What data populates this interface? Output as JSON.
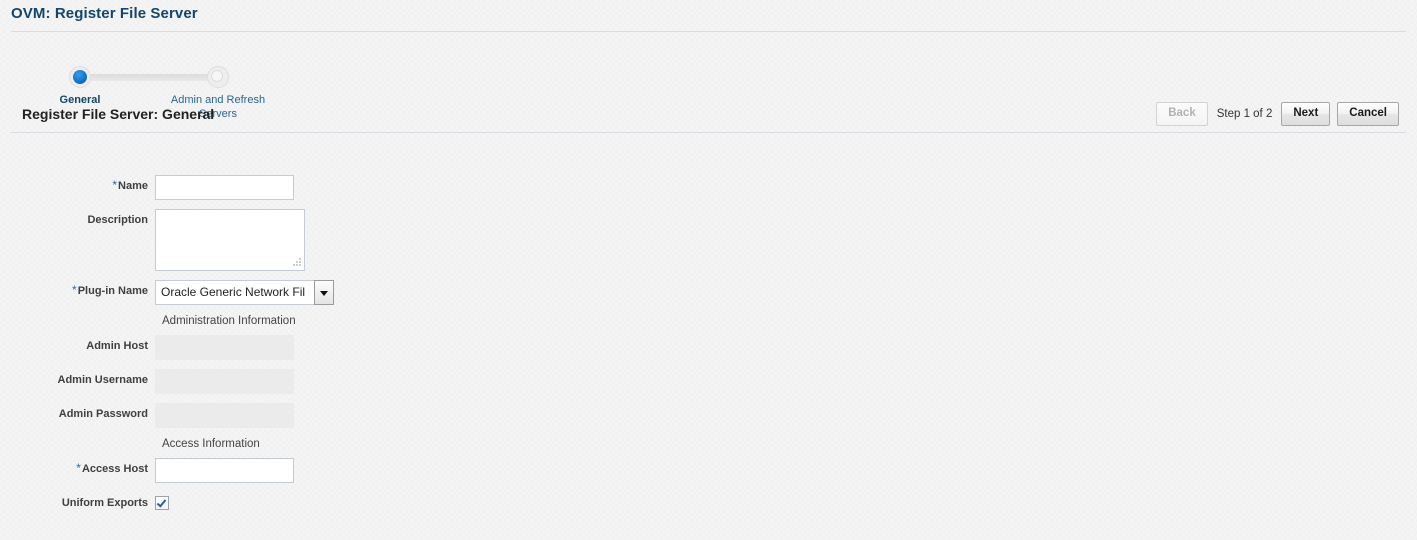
{
  "page": {
    "title": "OVM: Register File Server"
  },
  "train": {
    "steps": [
      {
        "label": "General",
        "state": "current"
      },
      {
        "label": "Admin and Refresh Servers",
        "state": "pending"
      }
    ]
  },
  "section": {
    "title": "Register File Server: General",
    "step_text": "Step 1 of 2",
    "buttons": {
      "back": "Back",
      "next": "Next",
      "cancel": "Cancel"
    }
  },
  "form": {
    "name": {
      "label": "Name",
      "required": true,
      "value": "",
      "placeholder": ""
    },
    "description": {
      "label": "Description",
      "required": false,
      "value": "",
      "placeholder": ""
    },
    "plugin_name": {
      "label": "Plug-in Name",
      "required": true,
      "value": "Oracle Generic Network Fil"
    },
    "admin_info_header": "Administration Information",
    "admin_host": {
      "label": "Admin Host",
      "required": false,
      "value": "",
      "disabled": true
    },
    "admin_username": {
      "label": "Admin Username",
      "required": false,
      "value": "",
      "disabled": true
    },
    "admin_password": {
      "label": "Admin Password",
      "required": false,
      "value": "",
      "disabled": true
    },
    "access_info_header": "Access Information",
    "access_host": {
      "label": "Access Host",
      "required": true,
      "value": "",
      "placeholder": ""
    },
    "uniform_exports": {
      "label": "Uniform Exports",
      "checked": true
    }
  },
  "colors": {
    "page_title": "#14456b",
    "required_marker": "#1e6bb8",
    "train_active": "#0a69c8",
    "link": "#2a6496",
    "background": "#f4f4f4"
  },
  "icons": {
    "dropdown": "chevron-down-icon",
    "checkbox_tick": "check-icon",
    "resize_grip": "resize-grip-icon"
  }
}
